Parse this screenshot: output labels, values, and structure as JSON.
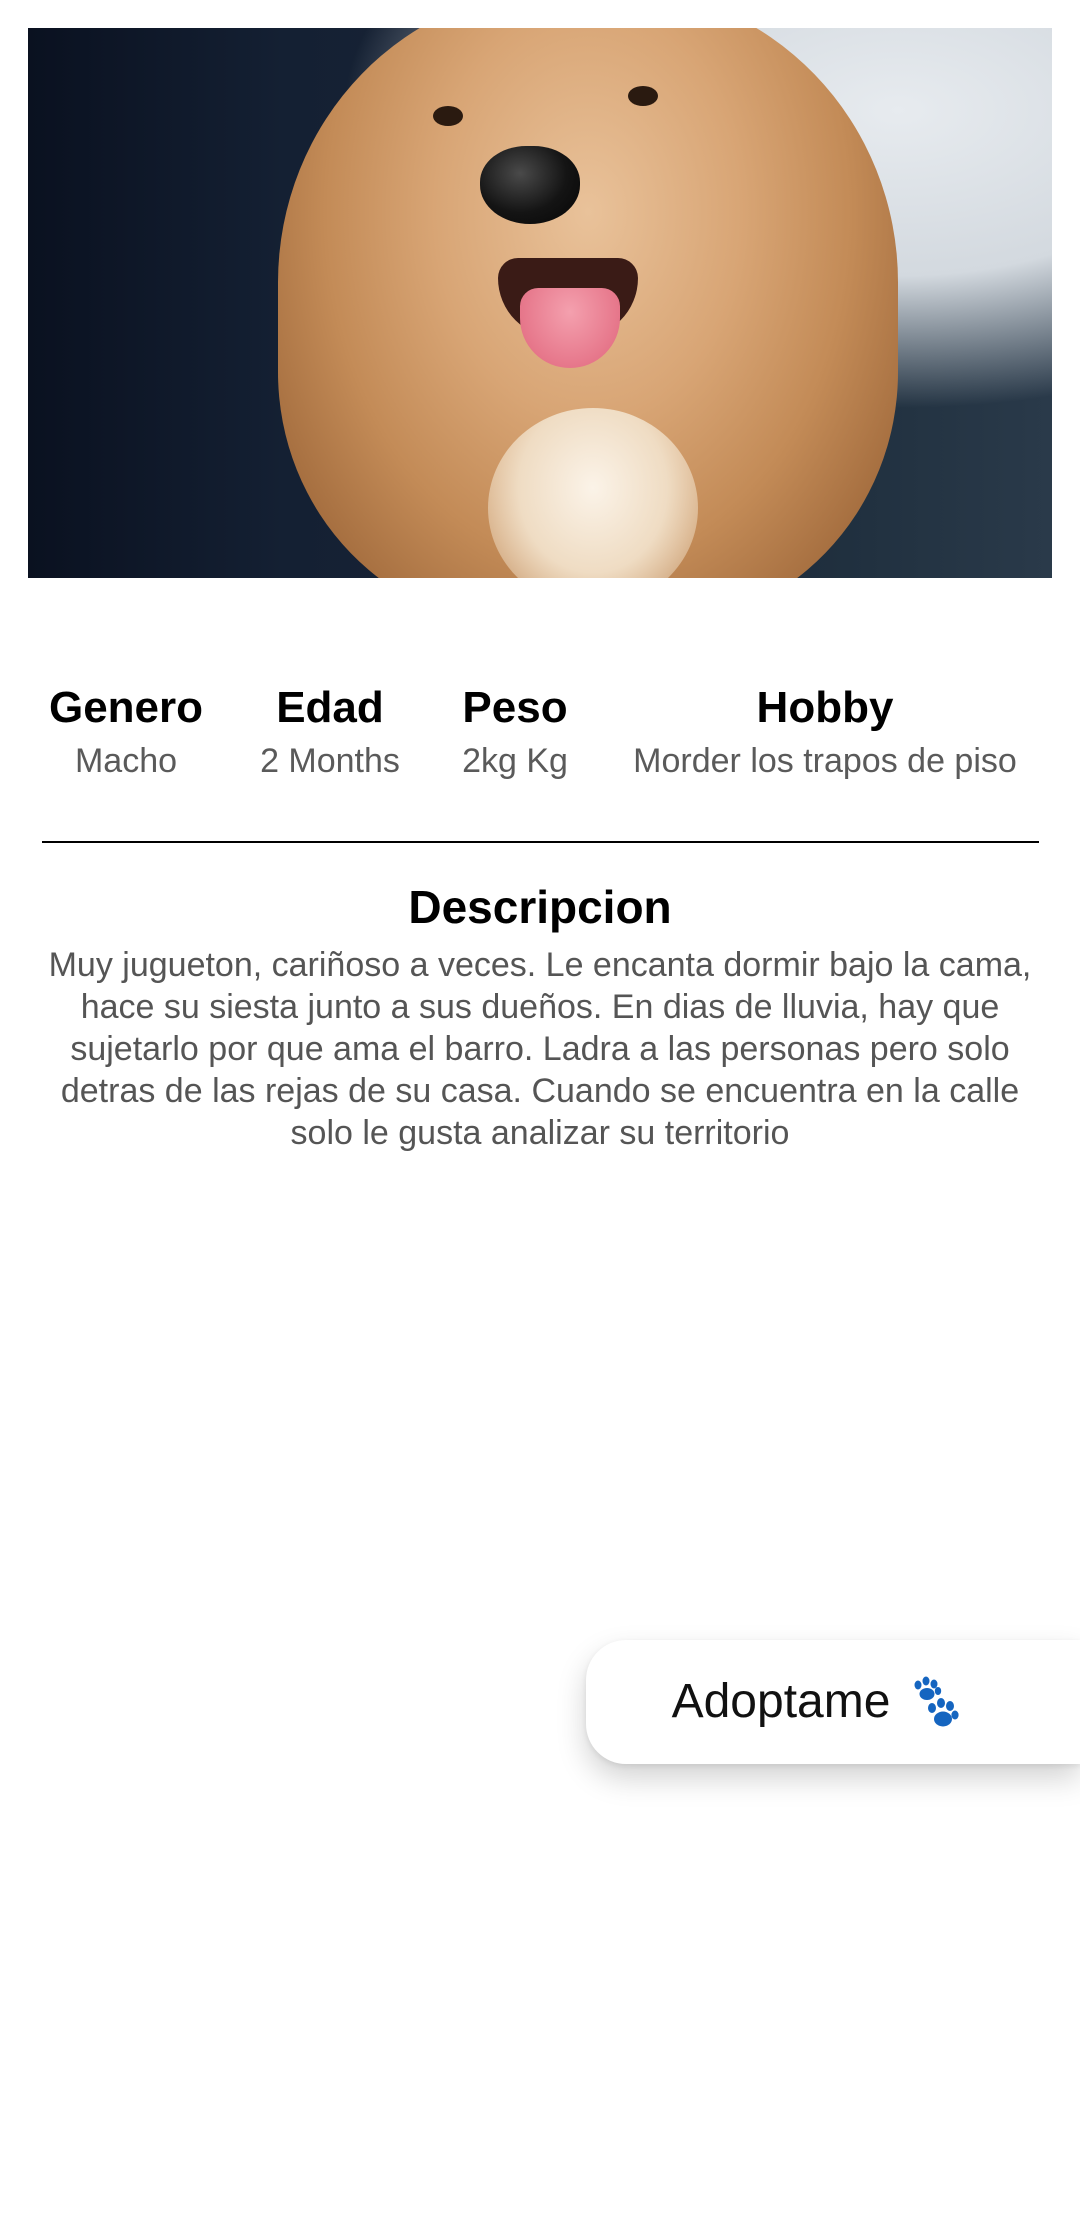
{
  "hero": {
    "image_alt": "small fluffy tan dog smiling with tongue out"
  },
  "info": [
    {
      "title": "Genero",
      "value": "Macho"
    },
    {
      "title": "Edad",
      "value": "2 Months"
    },
    {
      "title": "Peso",
      "value": "2kg Kg"
    },
    {
      "title": "Hobby",
      "value": "Morder los trapos de piso"
    }
  ],
  "description": {
    "title": "Descripcion",
    "text": "Muy jugueton, cariñoso a veces. Le encanta dormir bajo la cama, hace su siesta junto a sus dueños. En dias de lluvia, hay que sujetarlo por que ama el barro. Ladra a las personas pero solo detras de las rejas de su casa. Cuando se encuentra en la calle solo le gusta analizar su territorio"
  },
  "adopt_button": {
    "label": "Adoptame",
    "icon": "paw-prints-icon",
    "icon_color": "#1565c0"
  }
}
